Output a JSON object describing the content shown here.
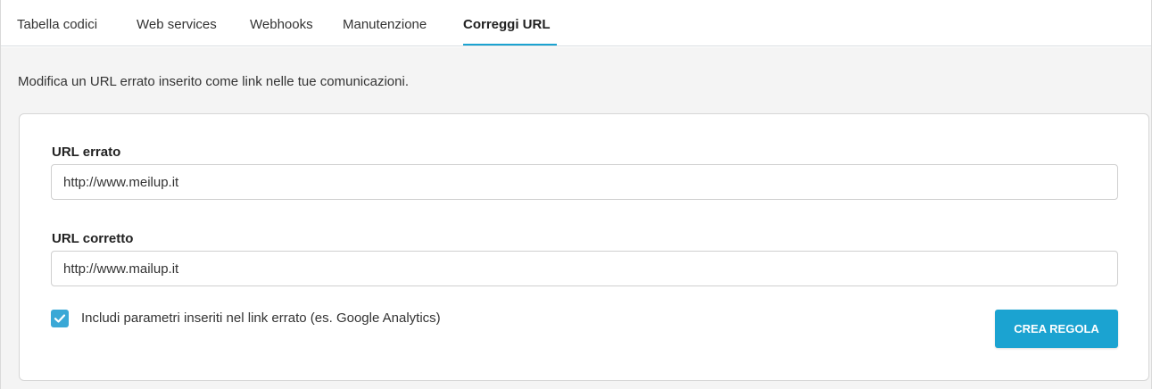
{
  "tabs": [
    {
      "label": "Tabella codici",
      "active": false
    },
    {
      "label": "Web services",
      "active": false
    },
    {
      "label": "Webhooks",
      "active": false
    },
    {
      "label": "Manutenzione",
      "active": false
    },
    {
      "label": "Correggi URL",
      "active": true
    }
  ],
  "description": "Modifica un URL errato inserito come link nelle tue comunicazioni.",
  "form": {
    "wrong_url": {
      "label": "URL errato",
      "value": "http://www.meilup.it"
    },
    "correct_url": {
      "label": "URL corretto",
      "value": "http://www.mailup.it"
    },
    "include_params": {
      "label": "Includi parametri inseriti nel link errato (es. Google Analytics)",
      "checked": true
    },
    "submit_label": "CREA REGOLA"
  },
  "colors": {
    "accent": "#1ba3d1",
    "checkbox": "#3aa8d6",
    "background": "#f4f4f4"
  },
  "icons": {
    "checkbox_check": "check-icon"
  }
}
